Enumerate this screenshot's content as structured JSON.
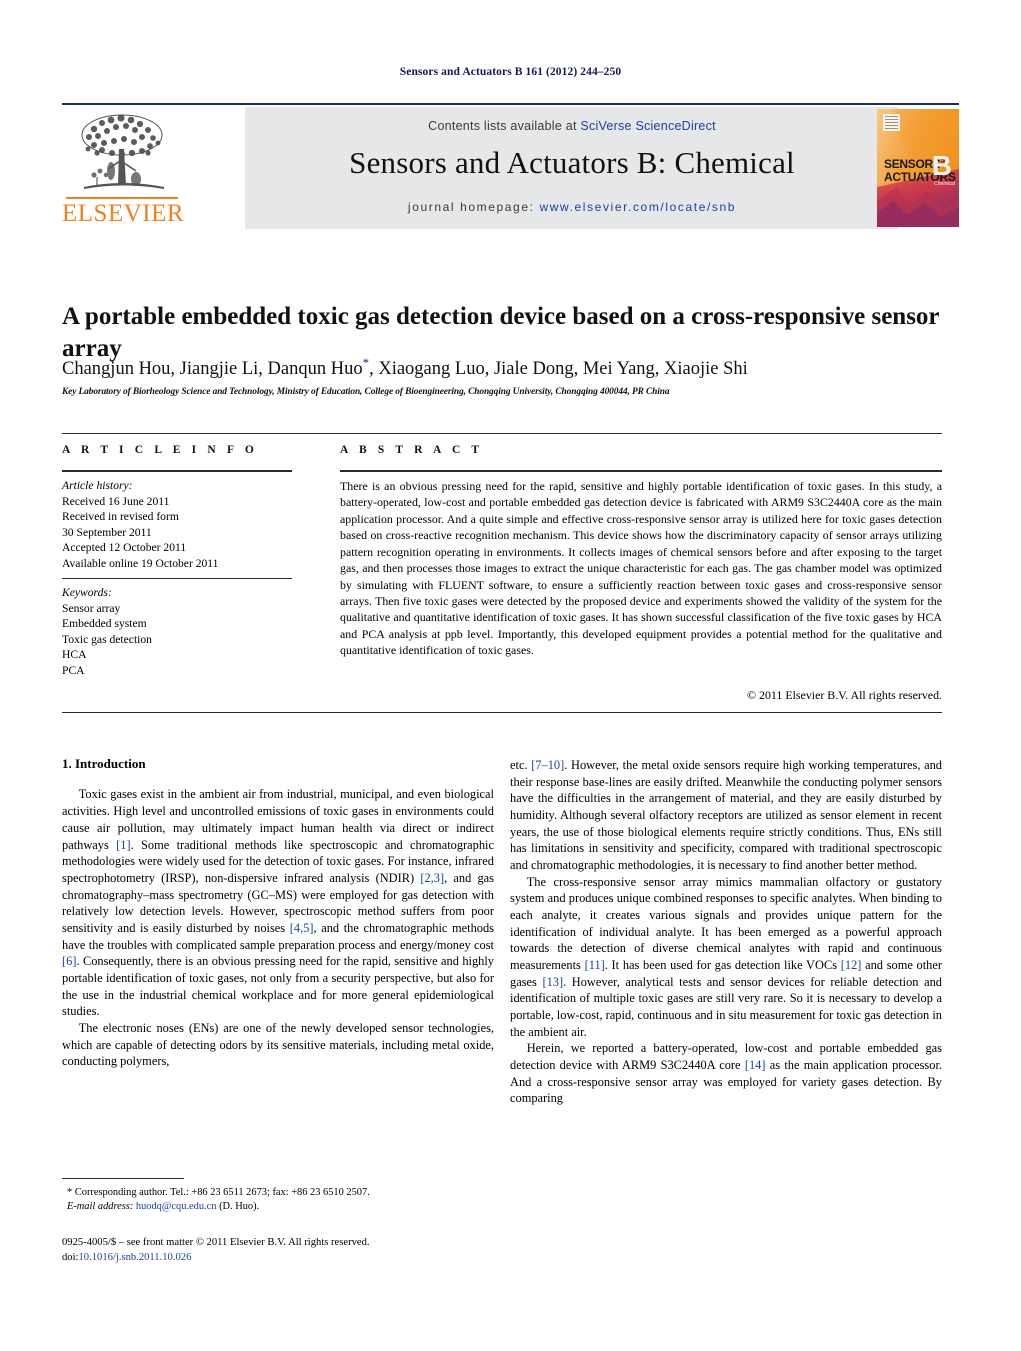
{
  "running_head": "Sensors and Actuators B 161 (2012) 244–250",
  "header": {
    "contents_prefix": "Contents lists available at ",
    "contents_link": "SciVerse ScienceDirect",
    "journal_title": "Sensors and Actuators B: Chemical",
    "homepage_prefix": "journal homepage: ",
    "homepage_url": "www.elsevier.com/locate/snb",
    "publisher_name": "ELSEVIER",
    "cover": {
      "line1": "SENSORS",
      "and": "and",
      "line2": "ACTUATORS",
      "letter": "B",
      "sub": "Chemical"
    }
  },
  "article": {
    "title": "A portable embedded toxic gas detection device based on a cross-responsive sensor array",
    "authors": "Changjun Hou, Jiangjie Li, Danqun Huo",
    "authors_rest": ", Xiaogang Luo, Jiale Dong, Mei Yang, Xiaojie Shi",
    "corresponding_marker": "*",
    "affiliation": "Key Laboratory of Biorheology Science and Technology, Ministry of Education, College of Bioengineering, Chongqing University, Chongqing 400044, PR China"
  },
  "info": {
    "label": "A R T I C L E   I N F O",
    "history_title": "Article history:",
    "history": [
      "Received 16 June 2011",
      "Received in revised form",
      "30 September 2011",
      "Accepted 12 October 2011",
      "Available online 19 October 2011"
    ],
    "keywords_title": "Keywords:",
    "keywords": [
      "Sensor array",
      "Embedded system",
      "Toxic gas detection",
      "HCA",
      "PCA"
    ]
  },
  "abstract": {
    "label": "A B S T R A C T",
    "text": "There is an obvious pressing need for the rapid, sensitive and highly portable identification of toxic gases. In this study, a battery-operated, low-cost and portable embedded gas detection device is fabricated with ARM9 S3C2440A core as the main application processor. And a quite simple and effective cross-responsive sensor array is utilized here for toxic gases detection based on cross-reactive recognition mechanism. This device shows how the discriminatory capacity of sensor arrays utilizing pattern recognition operating in environments. It collects images of chemical sensors before and after exposing to the target gas, and then processes those images to extract the unique characteristic for each gas. The gas chamber model was optimized by simulating with FLUENT software, to ensure a sufficiently reaction between toxic gases and cross-responsive sensor arrays. Then five toxic gases were detected by the proposed device and experiments showed the validity of the system for the qualitative and quantitative identification of toxic gases. It has shown successful classification of the five toxic gases by HCA and PCA analysis at ppb level. Importantly, this developed equipment provides a potential method for the qualitative and quantitative identification of toxic gases.",
    "copyright": "© 2011 Elsevier B.V. All rights reserved."
  },
  "body": {
    "section_number_title": "1.  Introduction",
    "left_paragraph_1_a": "Toxic gases exist in the ambient air from industrial, municipal, and even biological activities. High level and uncontrolled emissions of toxic gases in environments could cause air pollution, may ultimately impact human health via direct or indirect pathways ",
    "ref_1": "[1]",
    "left_paragraph_1_b": ". Some traditional methods like spectroscopic and chromatographic methodologies were widely used for the detection of toxic gases. For instance, infrared spectrophotometry (IRSP), non-dispersive infrared analysis (NDIR) ",
    "ref_23": "[2,3]",
    "left_paragraph_1_c": ", and gas chromatography–mass spectrometry (GC–MS) were employed for gas detection with relatively low detection levels. However, spectroscopic method suffers from poor sensitivity and is easily disturbed by noises ",
    "ref_45": "[4,5]",
    "left_paragraph_1_d": ", and the chromatographic methods have the troubles with complicated sample preparation process and energy/money cost ",
    "ref_6": "[6]",
    "left_paragraph_1_e": ". Consequently, there is an obvious pressing need for the rapid, sensitive and highly portable identification of toxic gases, not only from a security perspective, but also for the use in the industrial chemical workplace and for more general epidemiological studies.",
    "left_paragraph_2": "The electronic noses (ENs) are one of the newly developed sensor technologies, which are capable of detecting odors by its sensitive materials, including metal oxide, conducting polymers,",
    "right_paragraph_1_a": "etc. ",
    "ref_710": "[7–10]",
    "right_paragraph_1_b": ". However, the metal oxide sensors require high working temperatures, and their response base-lines are easily drifted. Meanwhile the conducting polymer sensors have the difficulties in the arrangement of material, and they are easily disturbed by humidity. Although several olfactory receptors are utilized as sensor element in recent years, the use of those biological elements require strictly conditions. Thus, ENs still has limitations in sensitivity and specificity, compared with traditional spectroscopic and chromatographic methodologies, it is necessary to find another better method.",
    "right_paragraph_2_a": "The cross-responsive sensor array mimics mammalian olfactory or gustatory system and produces unique combined responses to specific analytes. When binding to each analyte, it creates various signals and provides unique pattern for the identification of individual analyte. It has been emerged as a powerful approach towards the detection of diverse chemical analytes with rapid and continuous measurements ",
    "ref_11": "[11]",
    "right_paragraph_2_b": ". It has been used for gas detection like VOCs ",
    "ref_12": "[12]",
    "right_paragraph_2_c": " and some other gases ",
    "ref_13": "[13]",
    "right_paragraph_2_d": ". However, analytical tests and sensor devices for reliable detection and identification of multiple toxic gases are still very rare. So it is necessary to develop a portable, low-cost, rapid, continuous and in situ measurement for toxic gas detection in the ambient air.",
    "right_paragraph_3_a": "Herein, we reported a battery-operated, low-cost and portable embedded gas detection device with ARM9 S3C2440A core ",
    "ref_14": "[14]",
    "right_paragraph_3_b": " as the main application processor. And a cross-responsive sensor array was employed for variety gases detection. By comparing"
  },
  "footer": {
    "corresponding_marker": "*",
    "corresponding_text": "Corresponding author. Tel.: +86 23 6511 2673; fax: +86 23 6510 2507.",
    "email_label": "E-mail address:",
    "email": "huodq@cqu.edu.cn",
    "email_owner": "(D. Huo).",
    "issn_line": "0925-4005/$ – see front matter © 2011 Elsevier B.V. All rights reserved.",
    "doi_label": "doi:",
    "doi": "10.1016/j.snb.2011.10.026"
  },
  "colors": {
    "link": "#1a3fa8",
    "running_head": "#14175a",
    "elsevier_orange": "#f08020",
    "header_band": "#e6e7e9"
  }
}
